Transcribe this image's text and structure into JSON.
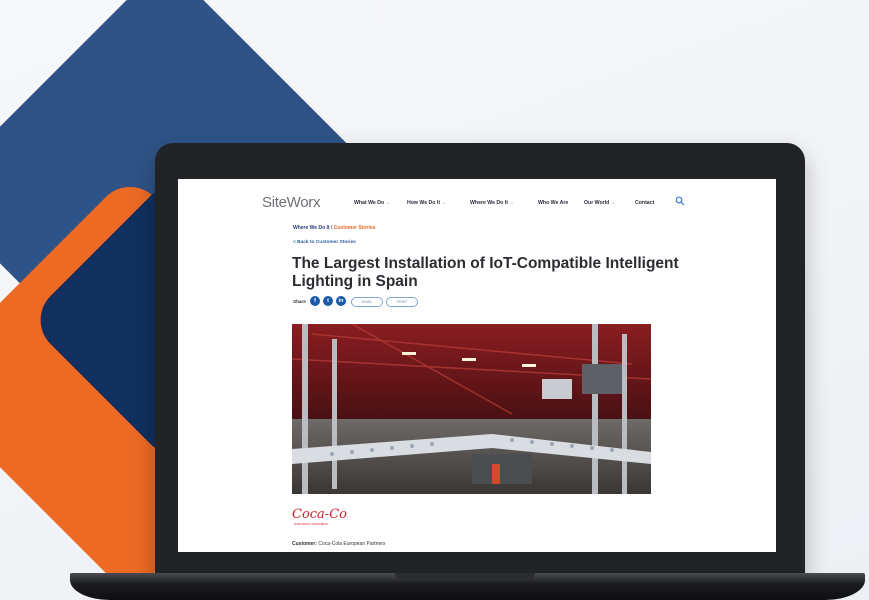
{
  "colors": {
    "brand_blue": "#2f5387",
    "brand_orange": "#ec6a24",
    "navy": "#11305e",
    "link_blue": "#2a5ea8",
    "accent_orange": "#e46a2a"
  },
  "site": {
    "logo": "SiteWorx"
  },
  "nav": {
    "items": [
      {
        "label": "What We Do",
        "has_dropdown": true
      },
      {
        "label": "How We Do It",
        "has_dropdown": true
      },
      {
        "label": "Where We Do It",
        "has_dropdown": true
      },
      {
        "label": "Who We Are",
        "has_dropdown": false
      },
      {
        "label": "Our World",
        "has_dropdown": true
      },
      {
        "label": "Contact",
        "has_dropdown": false
      }
    ],
    "search_icon": "search-icon"
  },
  "breadcrumb": {
    "parent": "Where We Do It",
    "separator": " / ",
    "current": "Customer Stories"
  },
  "back_link": "< Back to Customer Stories",
  "article": {
    "title": "The Largest Installation of IoT-Compatible Intelligent Lighting in Spain",
    "share_label": "Share",
    "social": [
      "facebook-icon",
      "twitter-icon",
      "linkedin-icon"
    ],
    "share_buttons": [
      "EMAIL",
      "PRINT"
    ],
    "hero_image": "factory bottling line",
    "logo_text": "Coca-Cola",
    "logo_subtext": "EUROPEAN PARTNERS",
    "customer_label": "Customer:",
    "customer_value": "Coca-Cola European Partners"
  }
}
